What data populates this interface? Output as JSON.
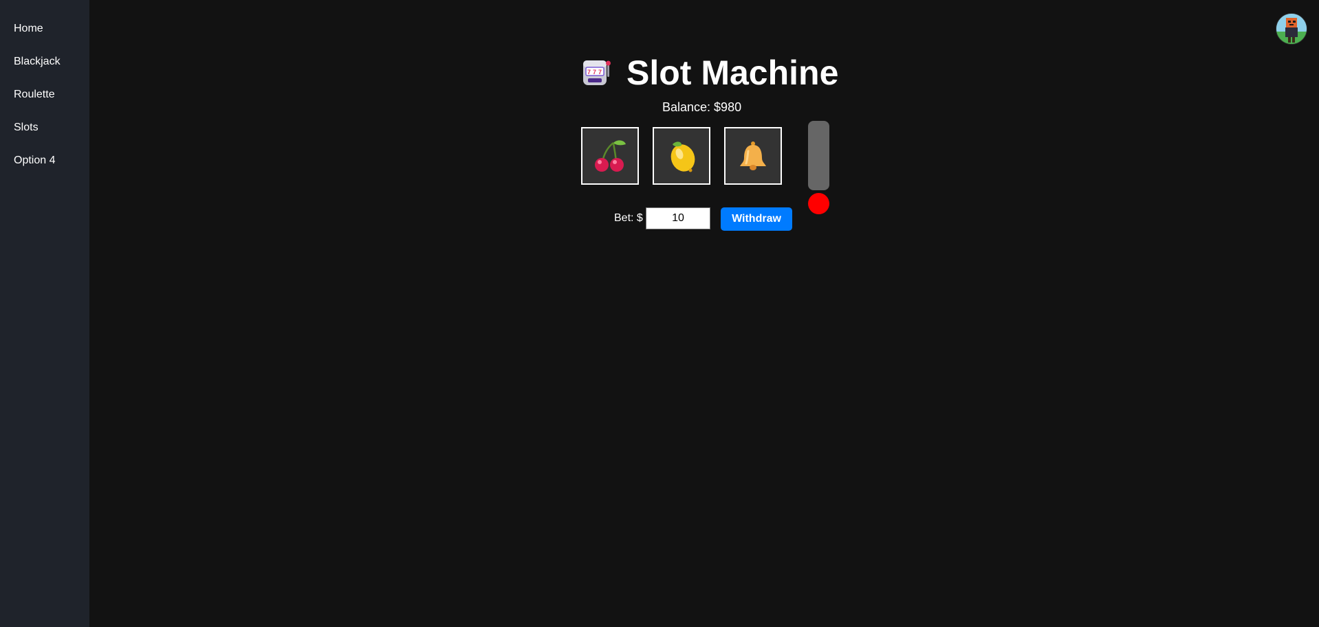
{
  "sidebar": {
    "items": [
      {
        "label": "Home"
      },
      {
        "label": "Blackjack"
      },
      {
        "label": "Roulette"
      },
      {
        "label": "Slots"
      },
      {
        "label": "Option 4"
      }
    ]
  },
  "header": {
    "title": "Slot Machine",
    "title_icon": "slot-machine-icon",
    "avatar_icon": "user-avatar"
  },
  "balance": {
    "text": "Balance: $980"
  },
  "reels": [
    {
      "symbol": "cherries-icon"
    },
    {
      "symbol": "lemon-icon"
    },
    {
      "symbol": "bell-icon"
    }
  ],
  "bet": {
    "label": "Bet: $",
    "value": "10"
  },
  "actions": {
    "withdraw_label": "Withdraw"
  },
  "colors": {
    "background": "#121212",
    "sidebar": "#1f232b",
    "reel_background": "#333333",
    "lever_bar": "#666666",
    "lever_knob": "#ff0000",
    "button": "#007bff"
  }
}
